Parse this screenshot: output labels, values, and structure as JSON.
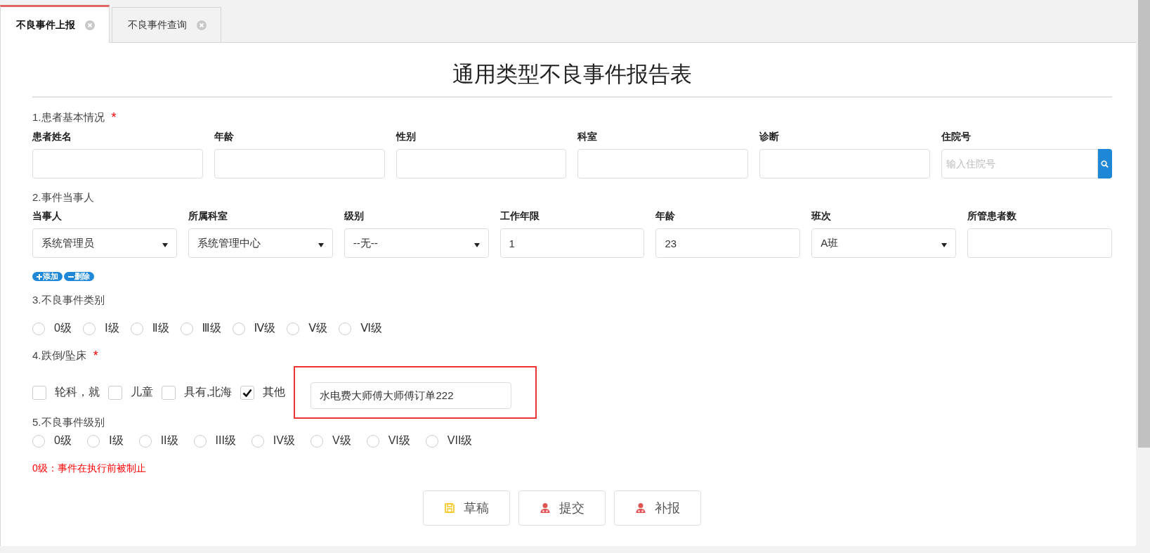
{
  "tabs": [
    {
      "label": "不良事件上报",
      "selected": true
    },
    {
      "label": "不良事件查询",
      "selected": false
    }
  ],
  "form": {
    "title": "通用类型不良事件报告表",
    "patient": {
      "heading": "1.患者基本情况",
      "required_mark": "*",
      "fields": [
        {
          "label": "患者姓名",
          "kind": "text"
        },
        {
          "label": "年龄",
          "kind": "text"
        },
        {
          "label": "性别",
          "kind": "text"
        },
        {
          "label": "科室",
          "kind": "text"
        },
        {
          "label": "诊断",
          "kind": "text"
        },
        {
          "label": "住院号",
          "kind": "search",
          "placeholder": "输入住院号"
        }
      ]
    },
    "party": {
      "heading": "2.事件当事人",
      "fields": [
        {
          "label": "当事人",
          "kind": "select",
          "value": "系统管理员"
        },
        {
          "label": "所属科室",
          "kind": "select",
          "value": "系统管理中心"
        },
        {
          "label": "级别",
          "kind": "select",
          "value": "--无--"
        },
        {
          "label": "工作年限",
          "kind": "text",
          "value": "1"
        },
        {
          "label": "年龄",
          "kind": "text",
          "value": "23"
        },
        {
          "label": "班次",
          "kind": "select",
          "value": "A班"
        },
        {
          "label": "所管患者数",
          "kind": "text"
        }
      ],
      "actions": [
        {
          "kind": "plus",
          "label": "添加"
        },
        {
          "kind": "minus",
          "label": "删除"
        }
      ]
    },
    "category": {
      "heading": "3.不良事件类别",
      "options": [
        {
          "label": "0级",
          "selected": false
        },
        {
          "label": "Ⅰ级",
          "selected": false
        },
        {
          "label": "Ⅱ级",
          "selected": false
        },
        {
          "label": "Ⅲ级",
          "selected": false
        },
        {
          "label": "Ⅳ级",
          "selected": false
        },
        {
          "label": "Ⅴ级",
          "selected": false
        },
        {
          "label": "Ⅵ级",
          "selected": false
        }
      ]
    },
    "fall": {
      "heading": "4.跌倒/坠床",
      "required_mark": "*",
      "options": [
        {
          "label": "轮科，就",
          "checked": false
        },
        {
          "label": "儿童",
          "checked": false
        },
        {
          "label": "具有,北海",
          "checked": false
        },
        {
          "label": "其他",
          "checked": true
        }
      ],
      "other_value": "水电费大师傅大师傅订单222",
      "highlighted": true
    },
    "level": {
      "heading": "5.不良事件级别",
      "options": [
        {
          "label": "0级",
          "selected": false
        },
        {
          "label": "Ⅰ级",
          "selected": false
        },
        {
          "label": "II级",
          "selected": false
        },
        {
          "label": "III级",
          "selected": false
        },
        {
          "label": "IV级",
          "selected": false
        },
        {
          "label": "V级",
          "selected": false
        },
        {
          "label": "VI级",
          "selected": false
        },
        {
          "label": "VII级",
          "selected": false
        }
      ],
      "note": "0级：事件在执行前被制止"
    },
    "buttons": [
      {
        "kind": "save",
        "label": "草稿"
      },
      {
        "kind": "person",
        "label": "提交"
      },
      {
        "kind": "person",
        "label": "补报"
      }
    ]
  }
}
